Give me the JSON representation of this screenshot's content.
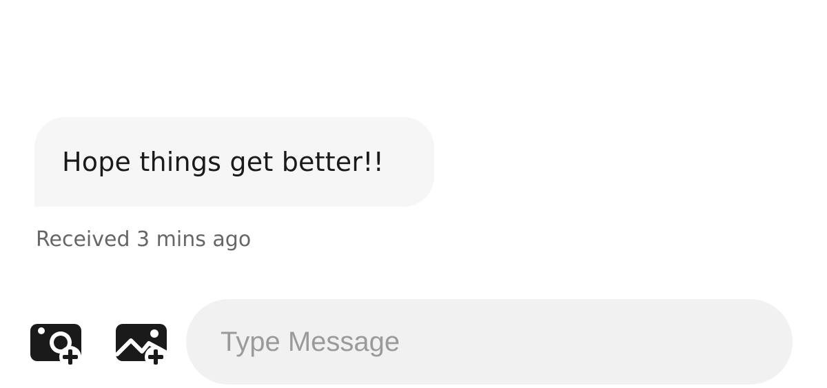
{
  "conversation": {
    "message": {
      "text": "Hope things get better!!",
      "status": "Received 3 mins ago"
    }
  },
  "composer": {
    "camera_icon": "add-camera-photo-icon",
    "gallery_icon": "add-gallery-image-icon",
    "placeholder": "Type Message",
    "value": ""
  },
  "colors": {
    "bubble": "#f6f6f6",
    "input": "#f1f1f1",
    "icon": "#1a1a1a",
    "status_text": "#666666",
    "placeholder_text": "#9a9a9a"
  }
}
